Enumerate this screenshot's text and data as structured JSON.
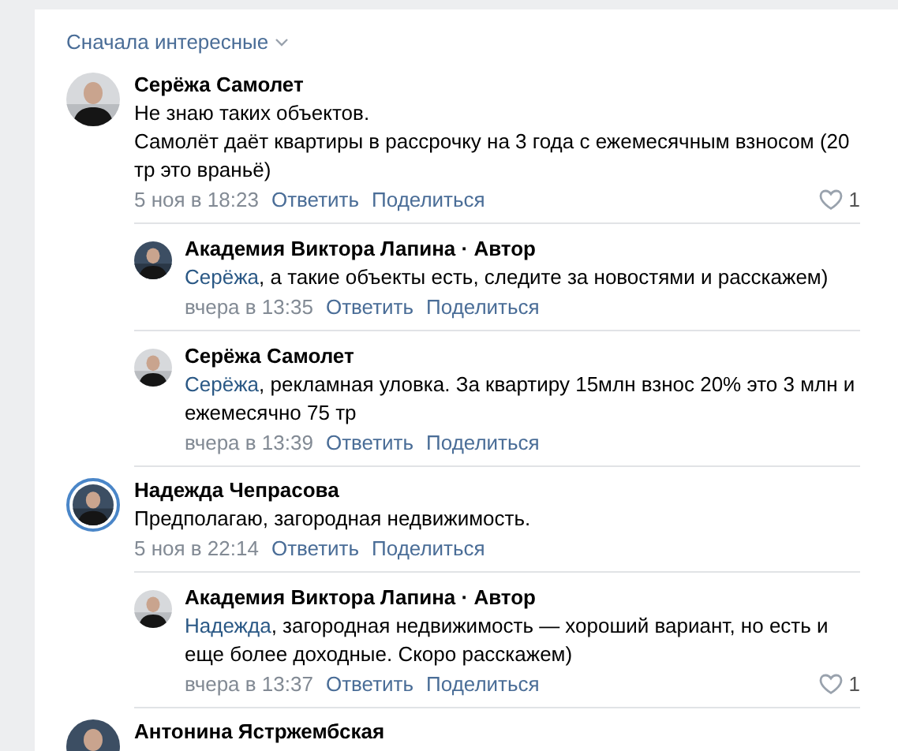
{
  "sort": {
    "label": "Сначала интересные"
  },
  "comments": [
    {
      "author": "Серёжа Самолет",
      "story_ring": false,
      "lines": [
        "Не знаю таких объектов.",
        "Самолёт даёт квартиры в рассрочку на 3 года с ежемесячным взносом (20 тр это враньё)"
      ],
      "date": "5 ноя в 18:23",
      "actions": [
        "Ответить",
        "Поделиться"
      ],
      "likes": "1",
      "replies": [
        {
          "author": "Академия Виктора Лапина · Автор",
          "mention": "Серёжа",
          "lines": [
            ", а такие объекты есть, следите за новостями и расскажем)"
          ],
          "date": "вчера в 13:35",
          "actions": [
            "Ответить",
            "Поделиться"
          ]
        },
        {
          "author": "Серёжа Самолет",
          "mention": "Серёжа",
          "lines": [
            ", рекламная уловка. За квартиру 15млн взнос 20% это 3 млн и ежемесячно 75 тр"
          ],
          "date": "вчера в 13:39",
          "actions": [
            "Ответить",
            "Поделиться"
          ]
        }
      ]
    },
    {
      "author": "Надежда Чепрасова",
      "story_ring": true,
      "lines": [
        "Предполагаю, загородная недвижимость."
      ],
      "date": "5 ноя в 22:14",
      "actions": [
        "Ответить",
        "Поделиться"
      ],
      "replies": [
        {
          "author": "Академия Виктора Лапина · Автор",
          "mention": "Надежда",
          "lines": [
            ", загородная недвижимость — хороший вариант, но есть и еще более доходные. Скоро расскажем)"
          ],
          "date": "вчера в 13:37",
          "actions": [
            "Ответить",
            "Поделиться"
          ],
          "likes": "1"
        }
      ]
    },
    {
      "author": "Антонина Ястржембская",
      "story_ring": false
    }
  ]
}
